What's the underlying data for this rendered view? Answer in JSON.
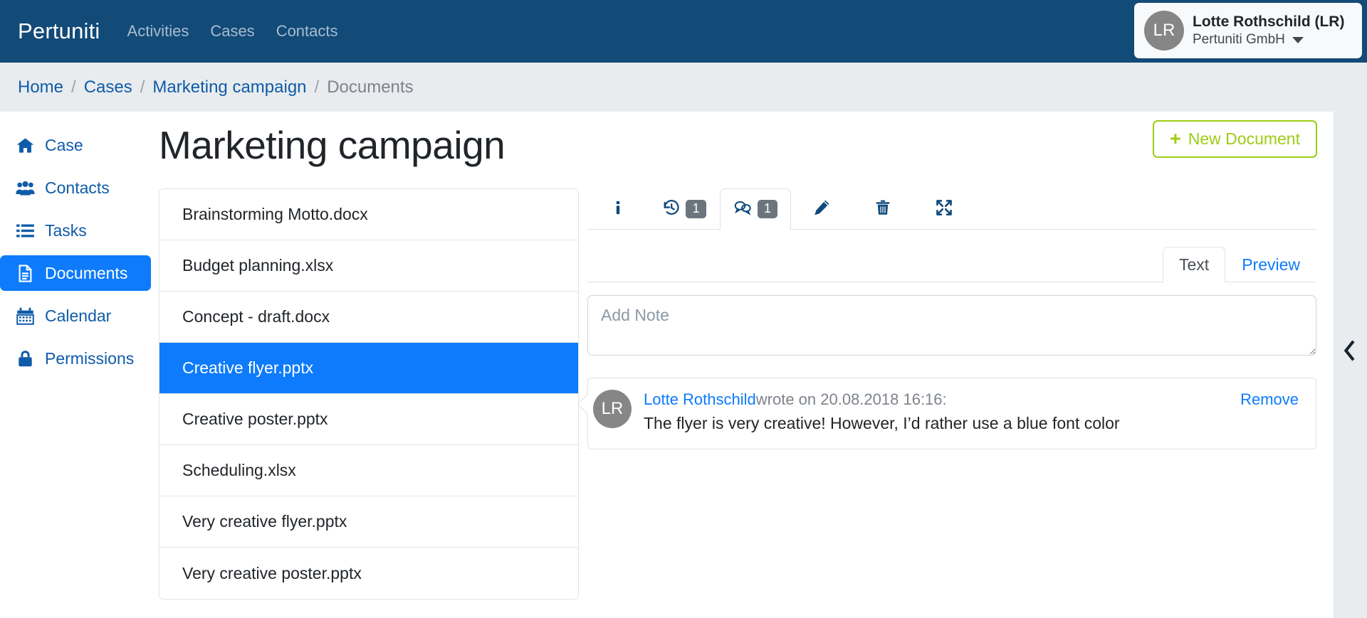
{
  "navbar": {
    "brand": "Pertuniti",
    "links": [
      {
        "label": "Activities",
        "name": "nav-link-activities"
      },
      {
        "label": "Cases",
        "name": "nav-link-cases"
      },
      {
        "label": "Contacts",
        "name": "nav-link-contacts"
      }
    ],
    "user": {
      "initials": "LR",
      "name": "Lotte Rothschild (LR)",
      "org": "Pertuniti GmbH",
      "caret_icon": "chevron-down-icon"
    },
    "bg_color": "#124a78"
  },
  "breadcrumb": {
    "separator": "/",
    "items": [
      {
        "label": "Home",
        "current": false
      },
      {
        "label": "Cases",
        "current": false
      },
      {
        "label": "Marketing campaign",
        "current": false
      },
      {
        "label": "Documents",
        "current": true
      }
    ]
  },
  "sidebar": {
    "items": [
      {
        "label": "Case",
        "icon": "home-icon",
        "active": false
      },
      {
        "label": "Contacts",
        "icon": "users-icon",
        "active": false
      },
      {
        "label": "Tasks",
        "icon": "list-icon",
        "active": false
      },
      {
        "label": "Documents",
        "icon": "document-icon",
        "active": true
      },
      {
        "label": "Calendar",
        "icon": "calendar-icon",
        "active": false
      },
      {
        "label": "Permissions",
        "icon": "lock-icon",
        "active": false
      }
    ],
    "active_color": "#0d7bfb",
    "link_color": "#0f5ba8"
  },
  "page": {
    "title": "Marketing campaign",
    "new_document_label": "New Document",
    "new_document_icon": "plus-icon",
    "new_document_color": "#9ccd12"
  },
  "documents": {
    "items": [
      {
        "name": "Brainstorming Motto.docx",
        "selected": false
      },
      {
        "name": "Budget planning.xlsx",
        "selected": false
      },
      {
        "name": "Concept - draft.docx",
        "selected": false
      },
      {
        "name": "Creative flyer.pptx",
        "selected": true
      },
      {
        "name": "Creative poster.pptx",
        "selected": false
      },
      {
        "name": "Scheduling.xlsx",
        "selected": false
      },
      {
        "name": "Very creative flyer.pptx",
        "selected": false
      },
      {
        "name": "Very creative poster.pptx",
        "selected": false
      }
    ]
  },
  "detail": {
    "toolbar": [
      {
        "icon": "info-icon",
        "badge": null,
        "active": false
      },
      {
        "icon": "history-icon",
        "badge": "1",
        "active": false
      },
      {
        "icon": "comments-icon",
        "badge": "1",
        "active": true
      },
      {
        "icon": "pencil-icon",
        "badge": null,
        "active": false
      },
      {
        "icon": "trash-icon",
        "badge": null,
        "active": false
      },
      {
        "icon": "expand-icon",
        "badge": null,
        "active": false
      }
    ],
    "sub_tabs": [
      {
        "label": "Text",
        "active": true
      },
      {
        "label": "Preview",
        "active": false
      }
    ],
    "note_placeholder": "Add Note",
    "note_value": "",
    "comments": [
      {
        "initials": "LR",
        "author": "Lotte Rothschild",
        "meta": " wrote on 20.08.2018 16:16:",
        "body": "The flyer is very creative! However, I’d rather use a blue font color",
        "remove_label": "Remove"
      }
    ],
    "collapse_icon": "chevron-left-icon"
  }
}
